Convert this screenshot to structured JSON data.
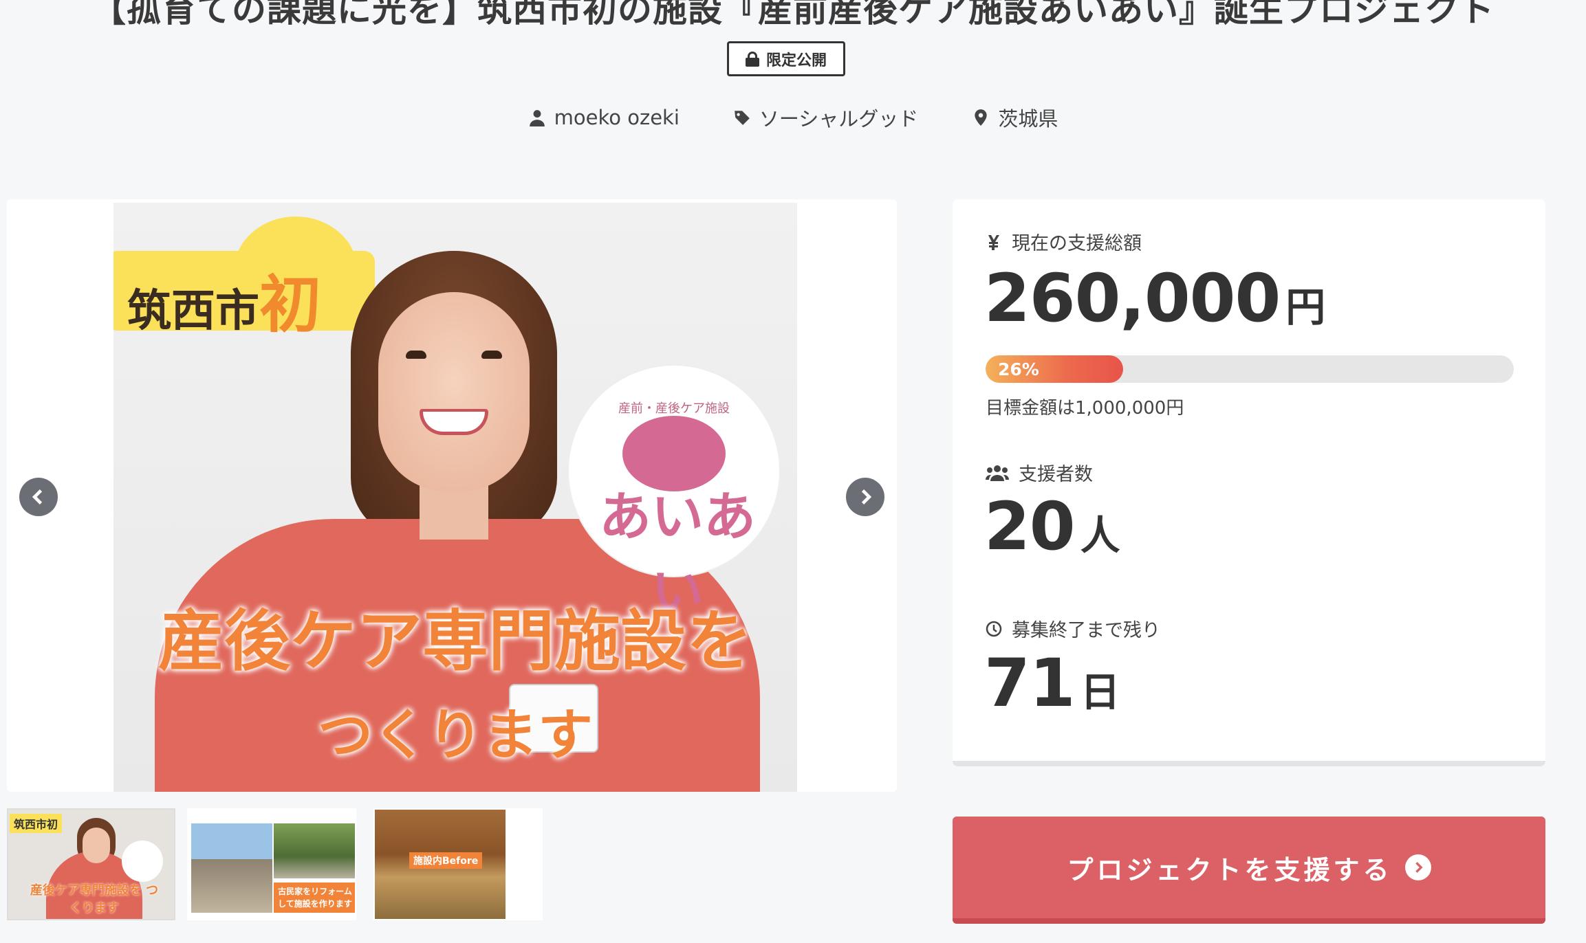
{
  "project": {
    "title": "【孤育ての課題に光を】筑西市初の施設『産前産後ケア施設あいあい』誕生プロジェクト",
    "badge_label": "限定公開",
    "owner": "moeko ozeki",
    "category": "ソーシャルグッド",
    "location": "茨城県"
  },
  "gallery": {
    "main_image": {
      "label_prefix": "筑西市",
      "label_highlight": "初",
      "logo_caption": "産前・産後ケア施設",
      "logo_text": "あいあい",
      "headline": "産後ケア専門施設を",
      "headline_2": "つくります"
    },
    "thumbnails": [
      {
        "label": "筑西市初",
        "caption": "産後ケア専門施設を つくります"
      },
      {
        "caption": "古民家をリフォーム して施設を作ります"
      },
      {
        "caption": "施設内Before"
      }
    ]
  },
  "funding": {
    "raised_label": "現在の支援総額",
    "raised_amount": "260,000",
    "raised_unit": "円",
    "progress_percent": 26,
    "progress_text": "26%",
    "goal_text": "目標金額は1,000,000円",
    "supporters_label": "支援者数",
    "supporters_count": "20",
    "supporters_unit": "人",
    "remaining_label": "募集終了まで残り",
    "remaining_days": "71",
    "remaining_unit": "日"
  },
  "cta": {
    "label": "プロジェクトを支援する"
  },
  "colors": {
    "accent": "#db6166",
    "progress_start": "#f4b15a",
    "progress_end": "#e8544a",
    "background": "#f6f7f9"
  },
  "icons": {
    "badge": "lock-icon",
    "owner": "user-icon",
    "category": "tag-icon",
    "location": "map-pin-icon",
    "raised": "yen-icon",
    "supporters": "users-icon",
    "remaining": "clock-icon",
    "cta": "chevron-circle-right-icon",
    "prev": "chevron-left-icon",
    "next": "chevron-right-icon"
  }
}
